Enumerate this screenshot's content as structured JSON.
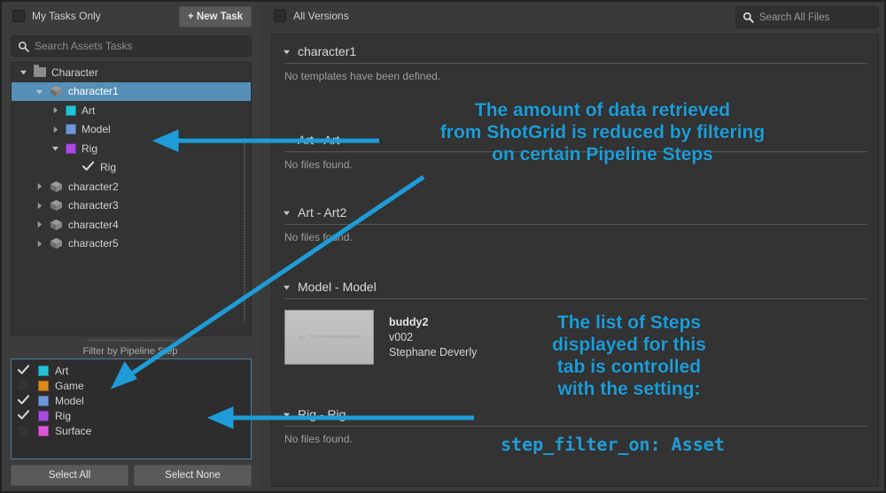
{
  "accent_color": "#1e9cd7",
  "selection_color": "#5690b8",
  "left_panel": {
    "my_tasks_only": {
      "label": "My Tasks Only",
      "checked": false
    },
    "new_task_button": "+ New Task",
    "search": {
      "placeholder": "Search Assets Tasks",
      "value": "",
      "icon": "search-icon"
    },
    "tree": [
      {
        "label": "Character",
        "depth": 0,
        "twisty": "down",
        "icon": "folder-icon",
        "chip": null,
        "selected": false
      },
      {
        "label": "character1",
        "depth": 1,
        "twisty": "down",
        "icon": "asset-cube-icon",
        "chip": null,
        "selected": true
      },
      {
        "label": "Art",
        "depth": 2,
        "twisty": "right",
        "icon": "color-chip",
        "chip": "#22c3d6",
        "selected": false
      },
      {
        "label": "Model",
        "depth": 2,
        "twisty": "right",
        "icon": "color-chip",
        "chip": "#6f96d6",
        "selected": false
      },
      {
        "label": "Rig",
        "depth": 2,
        "twisty": "down",
        "icon": "color-chip",
        "chip": "#a64ce0",
        "selected": false
      },
      {
        "label": "Rig",
        "depth": 3,
        "twisty": "none",
        "icon": "check-icon",
        "chip": null,
        "selected": false
      },
      {
        "label": "character2",
        "depth": 1,
        "twisty": "right",
        "icon": "asset-cube-icon",
        "chip": null,
        "selected": false
      },
      {
        "label": "character3",
        "depth": 1,
        "twisty": "right",
        "icon": "asset-cube-icon",
        "chip": null,
        "selected": false
      },
      {
        "label": "character4",
        "depth": 1,
        "twisty": "right",
        "icon": "asset-cube-icon",
        "chip": null,
        "selected": false
      },
      {
        "label": "character5",
        "depth": 1,
        "twisty": "right",
        "icon": "asset-cube-icon",
        "chip": null,
        "selected": false
      }
    ],
    "filter_label": "Filter by Pipeline Step",
    "pipeline_steps": [
      {
        "name": "Art",
        "color": "#22c3d6",
        "checked": true
      },
      {
        "name": "Game",
        "color": "#e08a1e",
        "checked": false
      },
      {
        "name": "Model",
        "color": "#6f96d6",
        "checked": true
      },
      {
        "name": "Rig",
        "color": "#a64ce0",
        "checked": true
      },
      {
        "name": "Surface",
        "color": "#e055d8",
        "checked": false
      }
    ],
    "select_all_button": "Select All",
    "select_none_button": "Select None"
  },
  "right_panel": {
    "all_versions": {
      "label": "All Versions",
      "checked": false
    },
    "search": {
      "placeholder": "Search All Files",
      "value": "",
      "icon": "search-icon"
    },
    "groups": [
      {
        "name": "character1",
        "empty_text": "No templates have been defined.",
        "files": []
      },
      {
        "name": "Art - Art",
        "empty_text": "No files found.",
        "files": []
      },
      {
        "name": "Art - Art2",
        "empty_text": "No files found.",
        "files": []
      },
      {
        "name": "Model - Model",
        "empty_text": "",
        "files": [
          {
            "thumb_text": "No Preview Available",
            "name": "buddy2",
            "version": "v002",
            "user": "Stephane Deverly"
          }
        ]
      },
      {
        "name": "Rig - Rig",
        "empty_text": "No files found.",
        "files": []
      }
    ]
  },
  "annotations": {
    "note_top": "The amount of data retrieved\nfrom ShotGrid is reduced by filtering\non certain Pipeline Steps",
    "note_top_lines": [
      "The amount of data retrieved",
      "from ShotGrid is reduced by filtering",
      "on certain Pipeline Steps"
    ],
    "note_bottom_lines": [
      "The list of Steps",
      "displayed for this",
      "tab is controlled",
      "with the setting:"
    ],
    "setting_text": "step_filter_on: Asset"
  }
}
